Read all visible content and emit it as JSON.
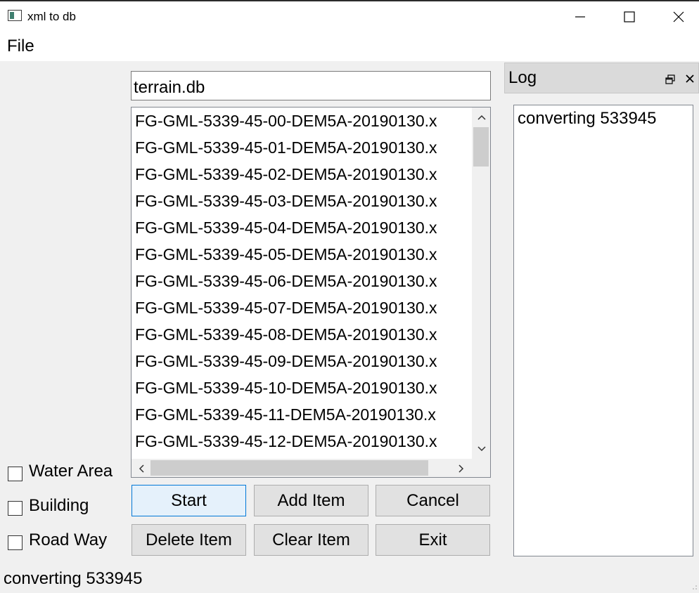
{
  "window": {
    "title": "xml to db",
    "controls": [
      "minimize",
      "maximize",
      "close"
    ]
  },
  "menubar": {
    "items": [
      "File"
    ]
  },
  "db_field": {
    "value": "terrain.db"
  },
  "file_list": {
    "items": [
      "FG-GML-5339-45-00-DEM5A-20190130.x",
      "FG-GML-5339-45-01-DEM5A-20190130.x",
      "FG-GML-5339-45-02-DEM5A-20190130.x",
      "FG-GML-5339-45-03-DEM5A-20190130.x",
      "FG-GML-5339-45-04-DEM5A-20190130.x",
      "FG-GML-5339-45-05-DEM5A-20190130.x",
      "FG-GML-5339-45-06-DEM5A-20190130.x",
      "FG-GML-5339-45-07-DEM5A-20190130.x",
      "FG-GML-5339-45-08-DEM5A-20190130.x",
      "FG-GML-5339-45-09-DEM5A-20190130.x",
      "FG-GML-5339-45-10-DEM5A-20190130.x",
      "FG-GML-5339-45-11-DEM5A-20190130.x",
      "FG-GML-5339-45-12-DEM5A-20190130.x"
    ]
  },
  "buttons": {
    "start": "Start",
    "add_item": "Add Item",
    "cancel": "Cancel",
    "delete_item": "Delete Item",
    "clear_item": "Clear Item",
    "exit": "Exit"
  },
  "checkboxes": {
    "water_area": {
      "label": "Water Area",
      "checked": false
    },
    "building": {
      "label": "Building",
      "checked": false
    },
    "road_way": {
      "label": "Road Way",
      "checked": false
    }
  },
  "log_panel": {
    "title": "Log",
    "text": "converting 533945"
  },
  "status_bar": {
    "text": "converting 533945"
  },
  "colors": {
    "focus_border": "#0078d7",
    "focus_fill": "#e5f1fb",
    "button_fill": "#e1e1e1",
    "window_bg": "#f0f0f0"
  }
}
